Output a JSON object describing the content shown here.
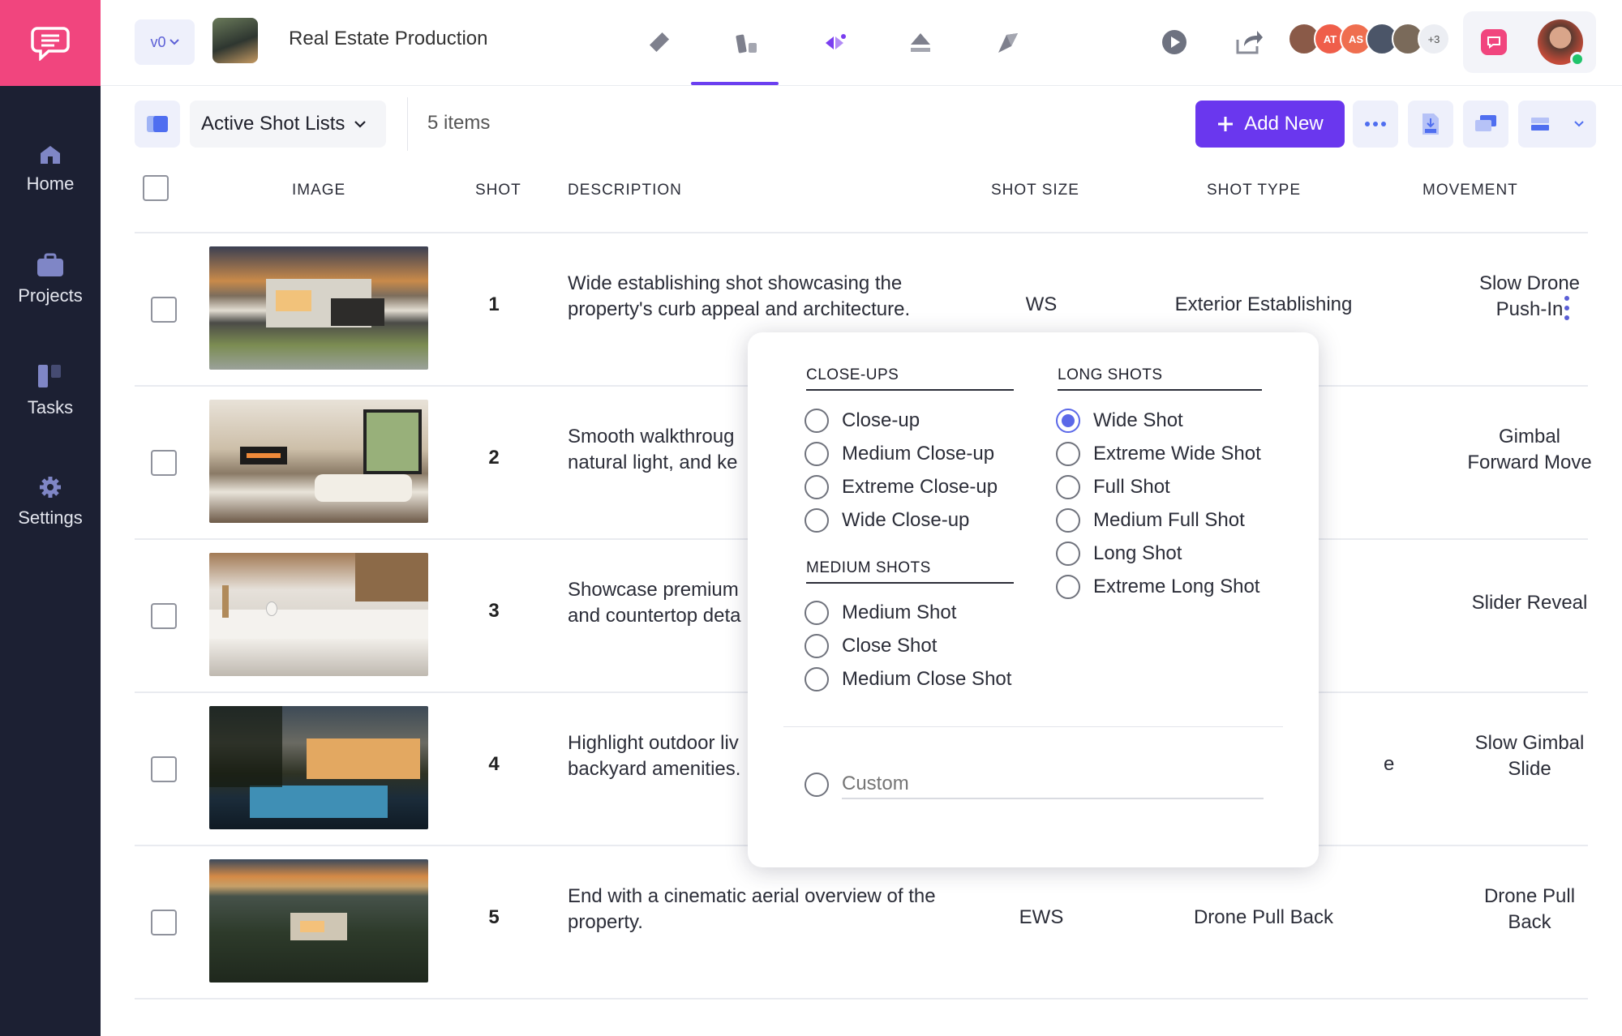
{
  "app": {
    "project_title": "Real Estate Production",
    "version_label": "v0",
    "avatars": [
      "AT",
      "AS",
      "+3"
    ]
  },
  "colors": {
    "sidebar_bg": "#1c2033",
    "brand_pink": "#f1457e",
    "accent_purple": "#6a37ee",
    "radio_selected": "#5b68e8"
  },
  "sidebar": {
    "items": [
      {
        "label": "Home",
        "icon": "home-icon"
      },
      {
        "label": "Projects",
        "icon": "briefcase-icon"
      },
      {
        "label": "Tasks",
        "icon": "tasks-icon"
      },
      {
        "label": "Settings",
        "icon": "gear-icon"
      }
    ]
  },
  "toolbar": {
    "list_name": "Active Shot Lists",
    "item_count": "5 items",
    "add_label": "Add New"
  },
  "table": {
    "headers": [
      "IMAGE",
      "SHOT",
      "DESCRIPTION",
      "SHOT SIZE",
      "SHOT TYPE",
      "MOVEMENT"
    ],
    "rows": [
      {
        "shot": "1",
        "desc1": "Wide establishing shot showcasing the",
        "desc2": "property's curb appeal and architecture.",
        "size": "WS",
        "type": "Exterior Establishing",
        "mov1": "Slow Drone",
        "mov2": "Push-In"
      },
      {
        "shot": "2",
        "desc1": "Smooth walkthroug",
        "desc2": "natural light, and ke",
        "size": "",
        "type": "",
        "mov1": "Gimbal",
        "mov2": "Forward Move"
      },
      {
        "shot": "3",
        "desc1": "Showcase premium",
        "desc2": "and countertop deta",
        "size": "",
        "type": "",
        "mov1": "Slider Reveal",
        "mov2": ""
      },
      {
        "shot": "4",
        "desc1": "Highlight outdoor liv",
        "desc2": "backyard amenities.",
        "size": "",
        "type": "e",
        "mov1": "Slow Gimbal",
        "mov2": "Slide"
      },
      {
        "shot": "5",
        "desc1": "End with a cinematic aerial overview of the",
        "desc2": "property.",
        "size": "EWS",
        "type": "Drone Pull Back",
        "mov1": "Drone Pull",
        "mov2": "Back"
      }
    ]
  },
  "shot_size_menu": {
    "closeups_title": "CLOSE-UPS",
    "closeups": [
      "Close-up",
      "Medium Close-up",
      "Extreme Close-up",
      "Wide Close-up"
    ],
    "medium_title": "MEDIUM SHOTS",
    "medium": [
      "Medium Shot",
      "Close Shot",
      "Medium Close Shot"
    ],
    "long_title": "LONG SHOTS",
    "long": [
      "Wide Shot",
      "Extreme Wide Shot",
      "Full Shot",
      "Medium Full Shot",
      "Long Shot",
      "Extreme Long Shot"
    ],
    "selected": "Wide Shot",
    "custom_placeholder": "Custom"
  }
}
